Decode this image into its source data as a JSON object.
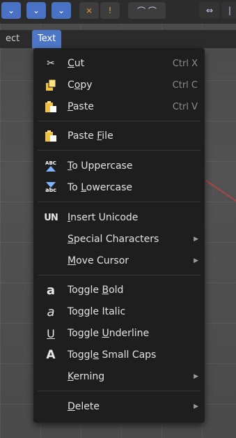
{
  "header": {
    "menus": [
      {
        "label": "ect"
      },
      {
        "label": "Text"
      }
    ]
  },
  "menu": {
    "items": [
      {
        "pre": "",
        "ul": "C",
        "post": "ut",
        "shortcut": "Ctrl X",
        "icon": "scissors-icon"
      },
      {
        "pre": "C",
        "ul": "o",
        "post": "py",
        "shortcut": "Ctrl C",
        "icon": "copy-icon"
      },
      {
        "pre": "",
        "ul": "P",
        "post": "aste",
        "shortcut": "Ctrl V",
        "icon": "paste-icon"
      },
      {
        "pre": "Paste ",
        "ul": "F",
        "post": "ile",
        "shortcut": "",
        "icon": "paste-file-icon"
      },
      {
        "pre": "",
        "ul": "T",
        "post": "o Uppercase",
        "shortcut": "",
        "icon": "uppercase-icon"
      },
      {
        "pre": "To ",
        "ul": "L",
        "post": "owercase",
        "shortcut": "",
        "icon": "lowercase-icon"
      },
      {
        "pre": "",
        "ul": "I",
        "post": "nsert Unicode",
        "shortcut": "",
        "icon": "unicode-icon"
      },
      {
        "pre": "",
        "ul": "S",
        "post": "pecial Characters",
        "shortcut": "",
        "icon": "",
        "submenu": true
      },
      {
        "pre": "",
        "ul": "M",
        "post": "ove Cursor",
        "shortcut": "",
        "icon": "",
        "submenu": true
      },
      {
        "pre": "Toggle ",
        "ul": "B",
        "post": "old",
        "shortcut": "",
        "icon": "bold-icon"
      },
      {
        "pre": "To",
        "ul": "g",
        "post": "gle Italic",
        "shortcut": "",
        "icon": "italic-icon"
      },
      {
        "pre": "Toggle ",
        "ul": "U",
        "post": "nderline",
        "shortcut": "",
        "icon": "underline-icon"
      },
      {
        "pre": "Toggl",
        "ul": "e",
        "post": " Small Caps",
        "shortcut": "",
        "icon": "small-caps-icon"
      },
      {
        "pre": "",
        "ul": "K",
        "post": "erning",
        "shortcut": "",
        "icon": "",
        "submenu": true
      },
      {
        "pre": "",
        "ul": "D",
        "post": "elete",
        "shortcut": "",
        "icon": "",
        "submenu": true
      }
    ],
    "icon_glyphs": {
      "scissors": "✂",
      "uppercase_top": "ABC",
      "lowercase_bottom": "abc",
      "unicode": "UN",
      "bold": "a",
      "italic": "a",
      "underline": "U",
      "small_caps": "A",
      "submenu_arrow": "▶"
    }
  },
  "colors": {
    "menu_bg": "#1e1e1e",
    "active_tab": "#4d77c6",
    "toolbar_blue": "#4a72c4",
    "paste_yellow": "#f0c040",
    "text": "#e2e2e2",
    "shortcut": "#8d8d8d"
  }
}
